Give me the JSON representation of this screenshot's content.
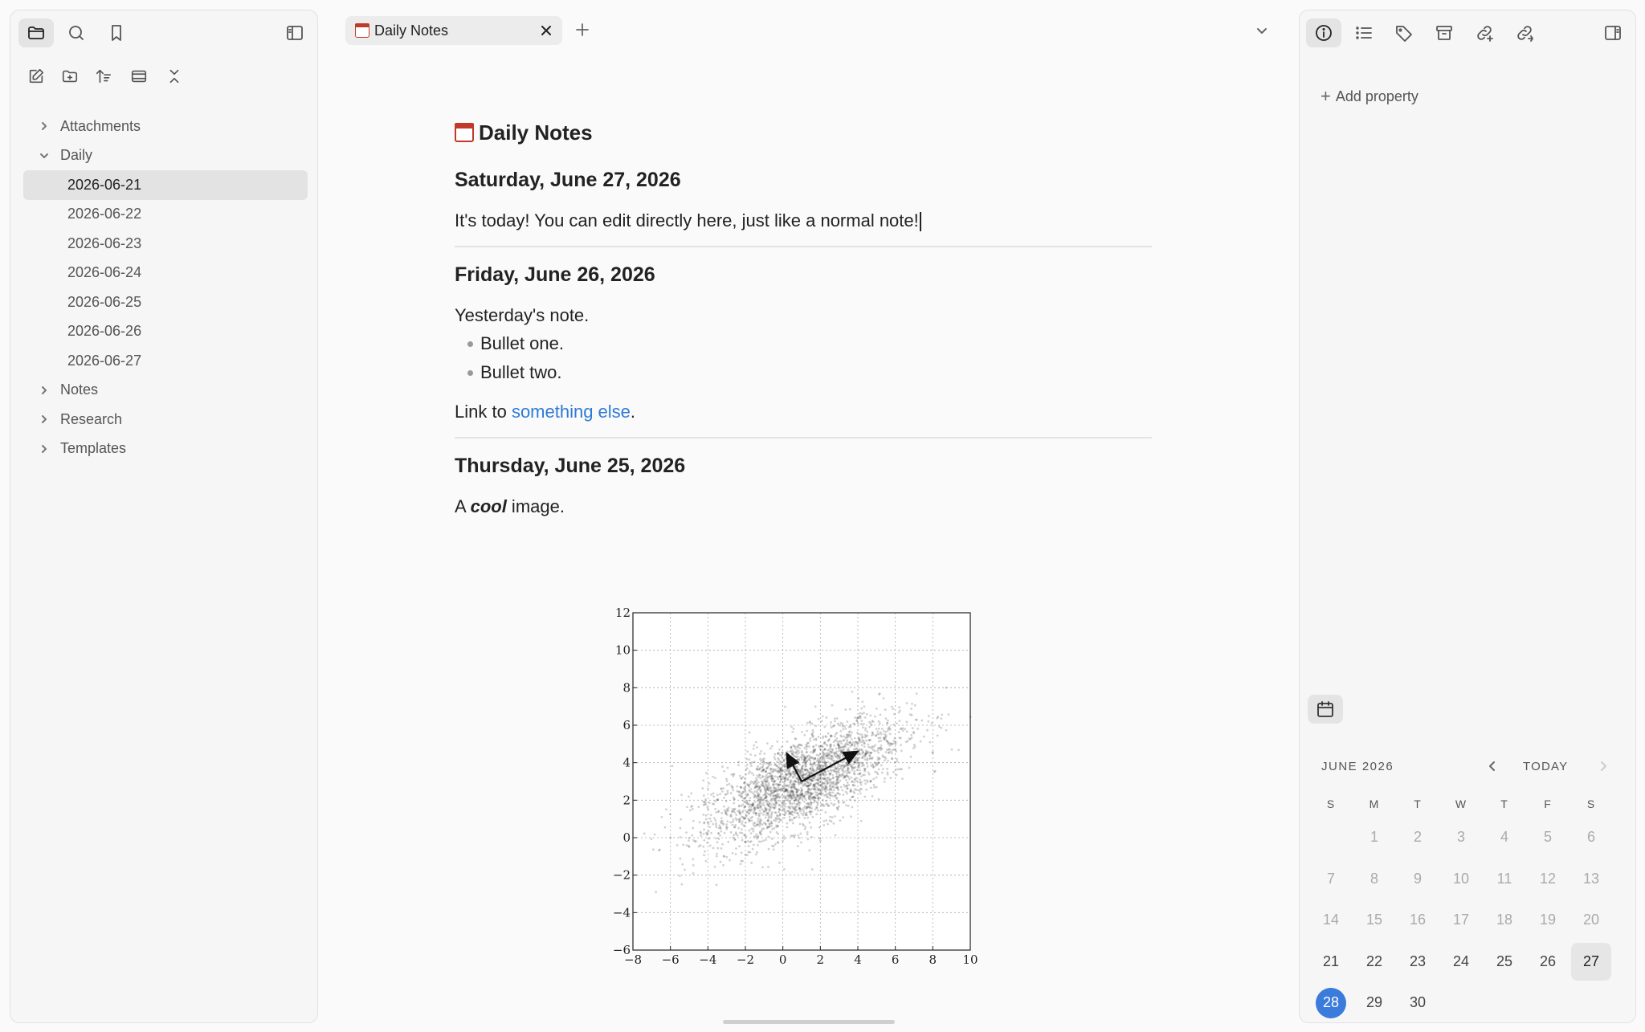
{
  "sidebar": {
    "tree": [
      {
        "label": "Attachments",
        "type": "folder",
        "expanded": false
      },
      {
        "label": "Daily",
        "type": "folder",
        "expanded": true
      },
      {
        "label": "2026-06-21",
        "type": "file",
        "selected": true
      },
      {
        "label": "2026-06-22",
        "type": "file"
      },
      {
        "label": "2026-06-23",
        "type": "file"
      },
      {
        "label": "2026-06-24",
        "type": "file"
      },
      {
        "label": "2026-06-25",
        "type": "file"
      },
      {
        "label": "2026-06-26",
        "type": "file"
      },
      {
        "label": "2026-06-27",
        "type": "file"
      },
      {
        "label": "Notes",
        "type": "folder",
        "expanded": false
      },
      {
        "label": "Research",
        "type": "folder",
        "expanded": false
      },
      {
        "label": "Templates",
        "type": "folder",
        "expanded": false
      }
    ]
  },
  "tab": {
    "title": "Daily Notes"
  },
  "doc": {
    "title": "Daily Notes",
    "entries": [
      {
        "heading": "Saturday, June 27, 2026",
        "text": "It's today! You can edit directly here, just like a normal note!"
      },
      {
        "heading": "Friday, June 26, 2026",
        "text": "Yesterday's note.",
        "bullets": [
          "Bullet one.",
          "Bullet two."
        ],
        "link_prefix": "Link to ",
        "link_text": "something else",
        "link_suffix": "."
      },
      {
        "heading": "Thursday, June 25, 2026",
        "text_prefix": "A ",
        "text_em": "cool",
        "text_suffix": " image."
      }
    ]
  },
  "chart_data": {
    "type": "scatter",
    "title": "",
    "xlabel": "",
    "ylabel": "",
    "xlim": [
      -8,
      10
    ],
    "ylim": [
      -6,
      12
    ],
    "xticks": [
      -8,
      -6,
      -4,
      -2,
      0,
      2,
      4,
      6,
      8,
      10
    ],
    "yticks": [
      -6,
      -4,
      -2,
      0,
      2,
      4,
      6,
      8,
      10,
      12
    ],
    "tick_labels_x": [
      "−8",
      "−6",
      "−4",
      "−2",
      "0",
      "2",
      "4",
      "6",
      "8",
      "10"
    ],
    "tick_labels_y": [
      "−6",
      "−4",
      "−2",
      "0",
      "2",
      "4",
      "6",
      "8",
      "10",
      "12"
    ],
    "grid": true,
    "distribution": {
      "mean": [
        1,
        3
      ],
      "description": "bivariate normal cloud"
    },
    "vectors": [
      {
        "from": [
          1,
          3
        ],
        "to": [
          4,
          4.6
        ]
      },
      {
        "from": [
          1,
          3
        ],
        "to": [
          0.2,
          4.5
        ]
      }
    ]
  },
  "right_panel": {
    "add_property": "Add property",
    "calendar": {
      "month": "JUNE 2026",
      "today_label": "TODAY",
      "weekdays": [
        "S",
        "M",
        "T",
        "W",
        "T",
        "F",
        "S"
      ],
      "weeks": [
        [
          "",
          "1",
          "2",
          "3",
          "4",
          "5",
          "6"
        ],
        [
          "7",
          "8",
          "9",
          "10",
          "11",
          "12",
          "13"
        ],
        [
          "14",
          "15",
          "16",
          "17",
          "18",
          "19",
          "20"
        ],
        [
          "21",
          "22",
          "23",
          "24",
          "25",
          "26",
          "27"
        ],
        [
          "28",
          "29",
          "30",
          "",
          "",
          "",
          ""
        ]
      ],
      "selected_day": "27",
      "today_day": "28"
    }
  }
}
